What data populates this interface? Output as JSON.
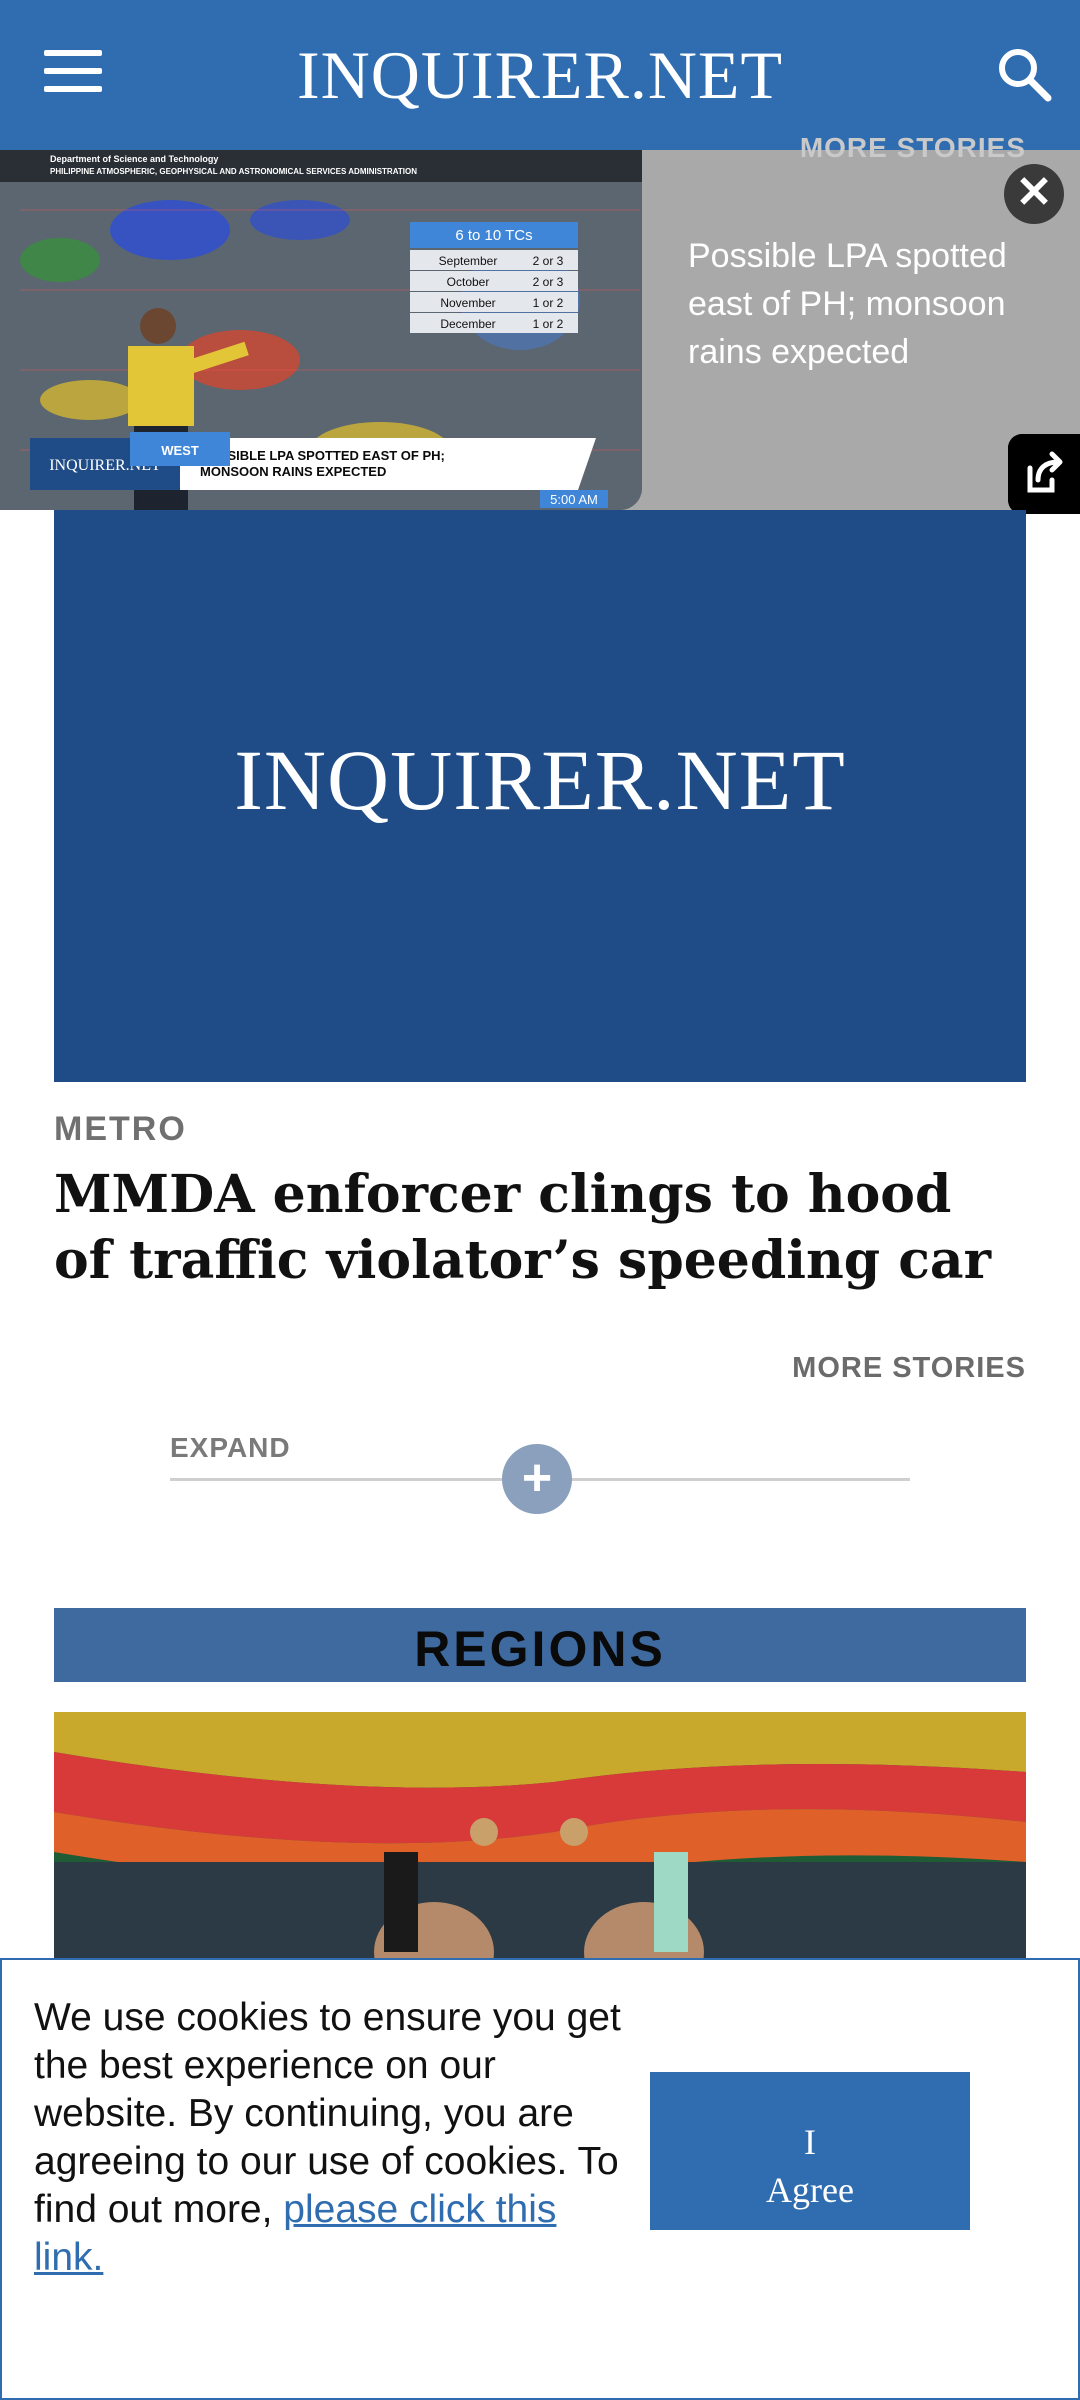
{
  "header": {
    "title": "INQUIRER.NET",
    "brand_color": "#2f6db0"
  },
  "video_widget": {
    "faded_label": "MORE STORIES",
    "caption": "Possible LPA spotted east of PH; monsoon rains expected",
    "thumb": {
      "agency_line1": "Department of Science and Technology",
      "agency_line2": "PHILIPPINE ATMOSPHERIC, GEOPHYSICAL AND ASTRONOMICAL SERVICES ADMINISTRATION",
      "table_title": "6 to 10 TCs",
      "table_rows": [
        {
          "month": "September",
          "value": "2 or 3"
        },
        {
          "month": "October",
          "value": "2 or 3"
        },
        {
          "month": "November",
          "value": "1 or 2"
        },
        {
          "month": "December",
          "value": "1 or 2"
        }
      ],
      "side_label": "WEST",
      "lower_brand": "INQUIRER.NET",
      "lower_headline_1": "POSSIBLE LPA SPOTTED EAST OF PH;",
      "lower_headline_2": "MONSOON RAINS EXPECTED",
      "time": "5:00 AM"
    },
    "close_icon": "close-icon",
    "share_icon": "external-link-icon"
  },
  "article": {
    "hero_logo": "INQUIRER.NET",
    "category": "METRO",
    "headline": "MMDA enforcer clings to hood of traffic violator’s speeding car",
    "more_stories": "MORE STORIES"
  },
  "expand": {
    "label": "EXPAND",
    "icon": "+"
  },
  "regions": {
    "title": "REGIONS"
  },
  "cookie_banner": {
    "text": "We use cookies to ensure you get the best experience on our website. By continuing, you are agreeing to our use of cookies. To find out more, ",
    "link_text": "please click this link.",
    "agree_line1": "I",
    "agree_line2": "Agree"
  },
  "colors": {
    "header": "#2f6db0",
    "hero_bg": "#1f4b86",
    "regions_bar": "#3e6aa0"
  }
}
